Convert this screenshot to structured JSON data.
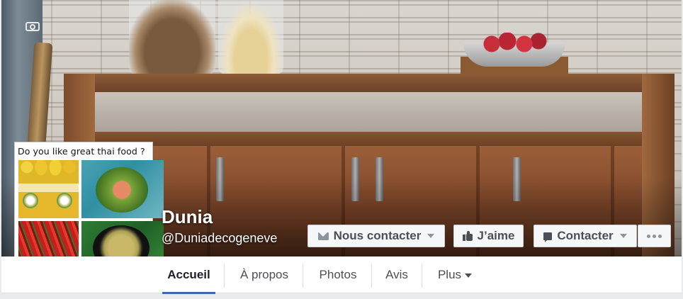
{
  "profile": {
    "caption": "Do you like great thai food ?",
    "name": "Dunia",
    "handle": "@Duniadecogeneve"
  },
  "icons": {
    "cover_camera": "camera-icon",
    "profile_camera": "camera-icon",
    "mail": "envelope-icon",
    "like": "thumbs-up-icon",
    "message": "speech-bubble-icon",
    "more": "ellipsis-icon"
  },
  "actions": {
    "contact_us": "Nous contacter",
    "like": "J’aime",
    "message": "Contacter"
  },
  "tabs": [
    {
      "label": "Accueil",
      "active": true
    },
    {
      "label": "À propos"
    },
    {
      "label": "Photos"
    },
    {
      "label": "Avis"
    },
    {
      "label": "Plus"
    }
  ],
  "colors": {
    "accent": "#4267b2",
    "button_bg": "#f6f7f9",
    "button_text": "#4b4f56"
  }
}
